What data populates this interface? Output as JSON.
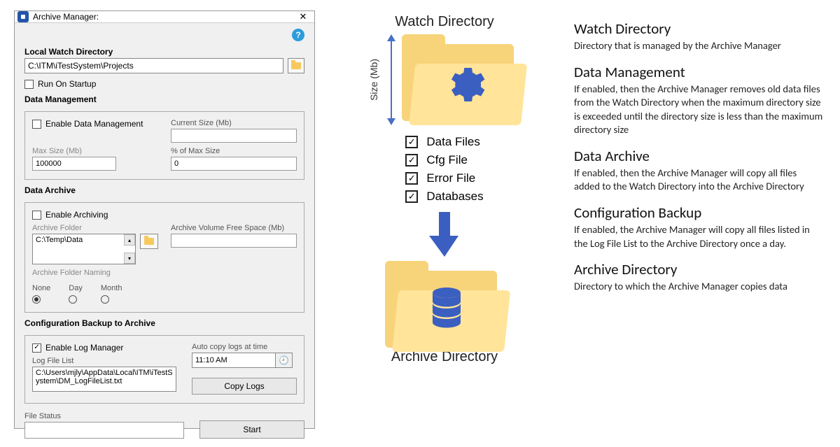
{
  "window": {
    "title": "Archive Manager:",
    "close_glyph": "✕"
  },
  "watch": {
    "label": "Local Watch Directory",
    "value": "C:\\ITM\\iTestSystem\\Projects",
    "run_on_startup_label": "Run On Startup",
    "run_on_startup_checked": false
  },
  "dataManagement": {
    "title": "Data Management",
    "enable_label": "Enable Data Management",
    "enable_checked": false,
    "current_size_label": "Current Size (Mb)",
    "current_size_value": "",
    "max_size_label": "Max Size (Mb)",
    "max_size_value": "100000",
    "percent_label": "% of Max Size",
    "percent_value": "0"
  },
  "dataArchive": {
    "title": "Data Archive",
    "enable_label": "Enable Archiving",
    "enable_checked": false,
    "archive_folder_label": "Archive Folder",
    "archive_folder_value": "C:\\Temp\\Data",
    "free_space_label": "Archive Volume Free Space (Mb)",
    "free_space_value": "",
    "naming_label": "Archive Folder Naming",
    "naming_options": [
      "None",
      "Day",
      "Month"
    ],
    "naming_selected": "None"
  },
  "configBackup": {
    "title": "Configuration Backup to Archive",
    "enable_label": "Enable Log Manager",
    "enable_checked": true,
    "log_file_list_label": "Log File List",
    "log_file_list_value": "C:\\Users\\mjly\\AppData\\Local\\ITM\\iTestSystem\\DM_LogFileList.txt",
    "auto_copy_label": "Auto copy logs at time",
    "auto_copy_value": "11:10 AM",
    "copy_logs_button": "Copy Logs"
  },
  "footer": {
    "file_status_label": "File Status",
    "file_status_value": "",
    "start_button": "Start"
  },
  "diagram": {
    "watch_title": "Watch Directory",
    "archive_title": "Archive Directory",
    "size_label": "Size (Mb)",
    "checks": [
      "Data Files",
      "Cfg File",
      "Error File",
      "Databases"
    ]
  },
  "definitions": [
    {
      "title": "Watch Directory",
      "body": "Directory that is managed by the Archive Manager"
    },
    {
      "title": "Data Management",
      "body": "If enabled, then the Archive Manager removes old data files from the  Watch Directory when the maximum directory size is exceeded until the directory size is less than the maximum directory size"
    },
    {
      "title": "Data Archive",
      "body": "If enabled, then the Archive Manager will copy all files added to the Watch Directory into the Archive Directory"
    },
    {
      "title": "Configuration Backup",
      "body": "If enabled, the Archive Manager will copy all files listed in the Log File List to the Archive Directory once a day."
    },
    {
      "title": "Archive Directory",
      "body": "Directory to which the Archive Manager copies data"
    }
  ]
}
